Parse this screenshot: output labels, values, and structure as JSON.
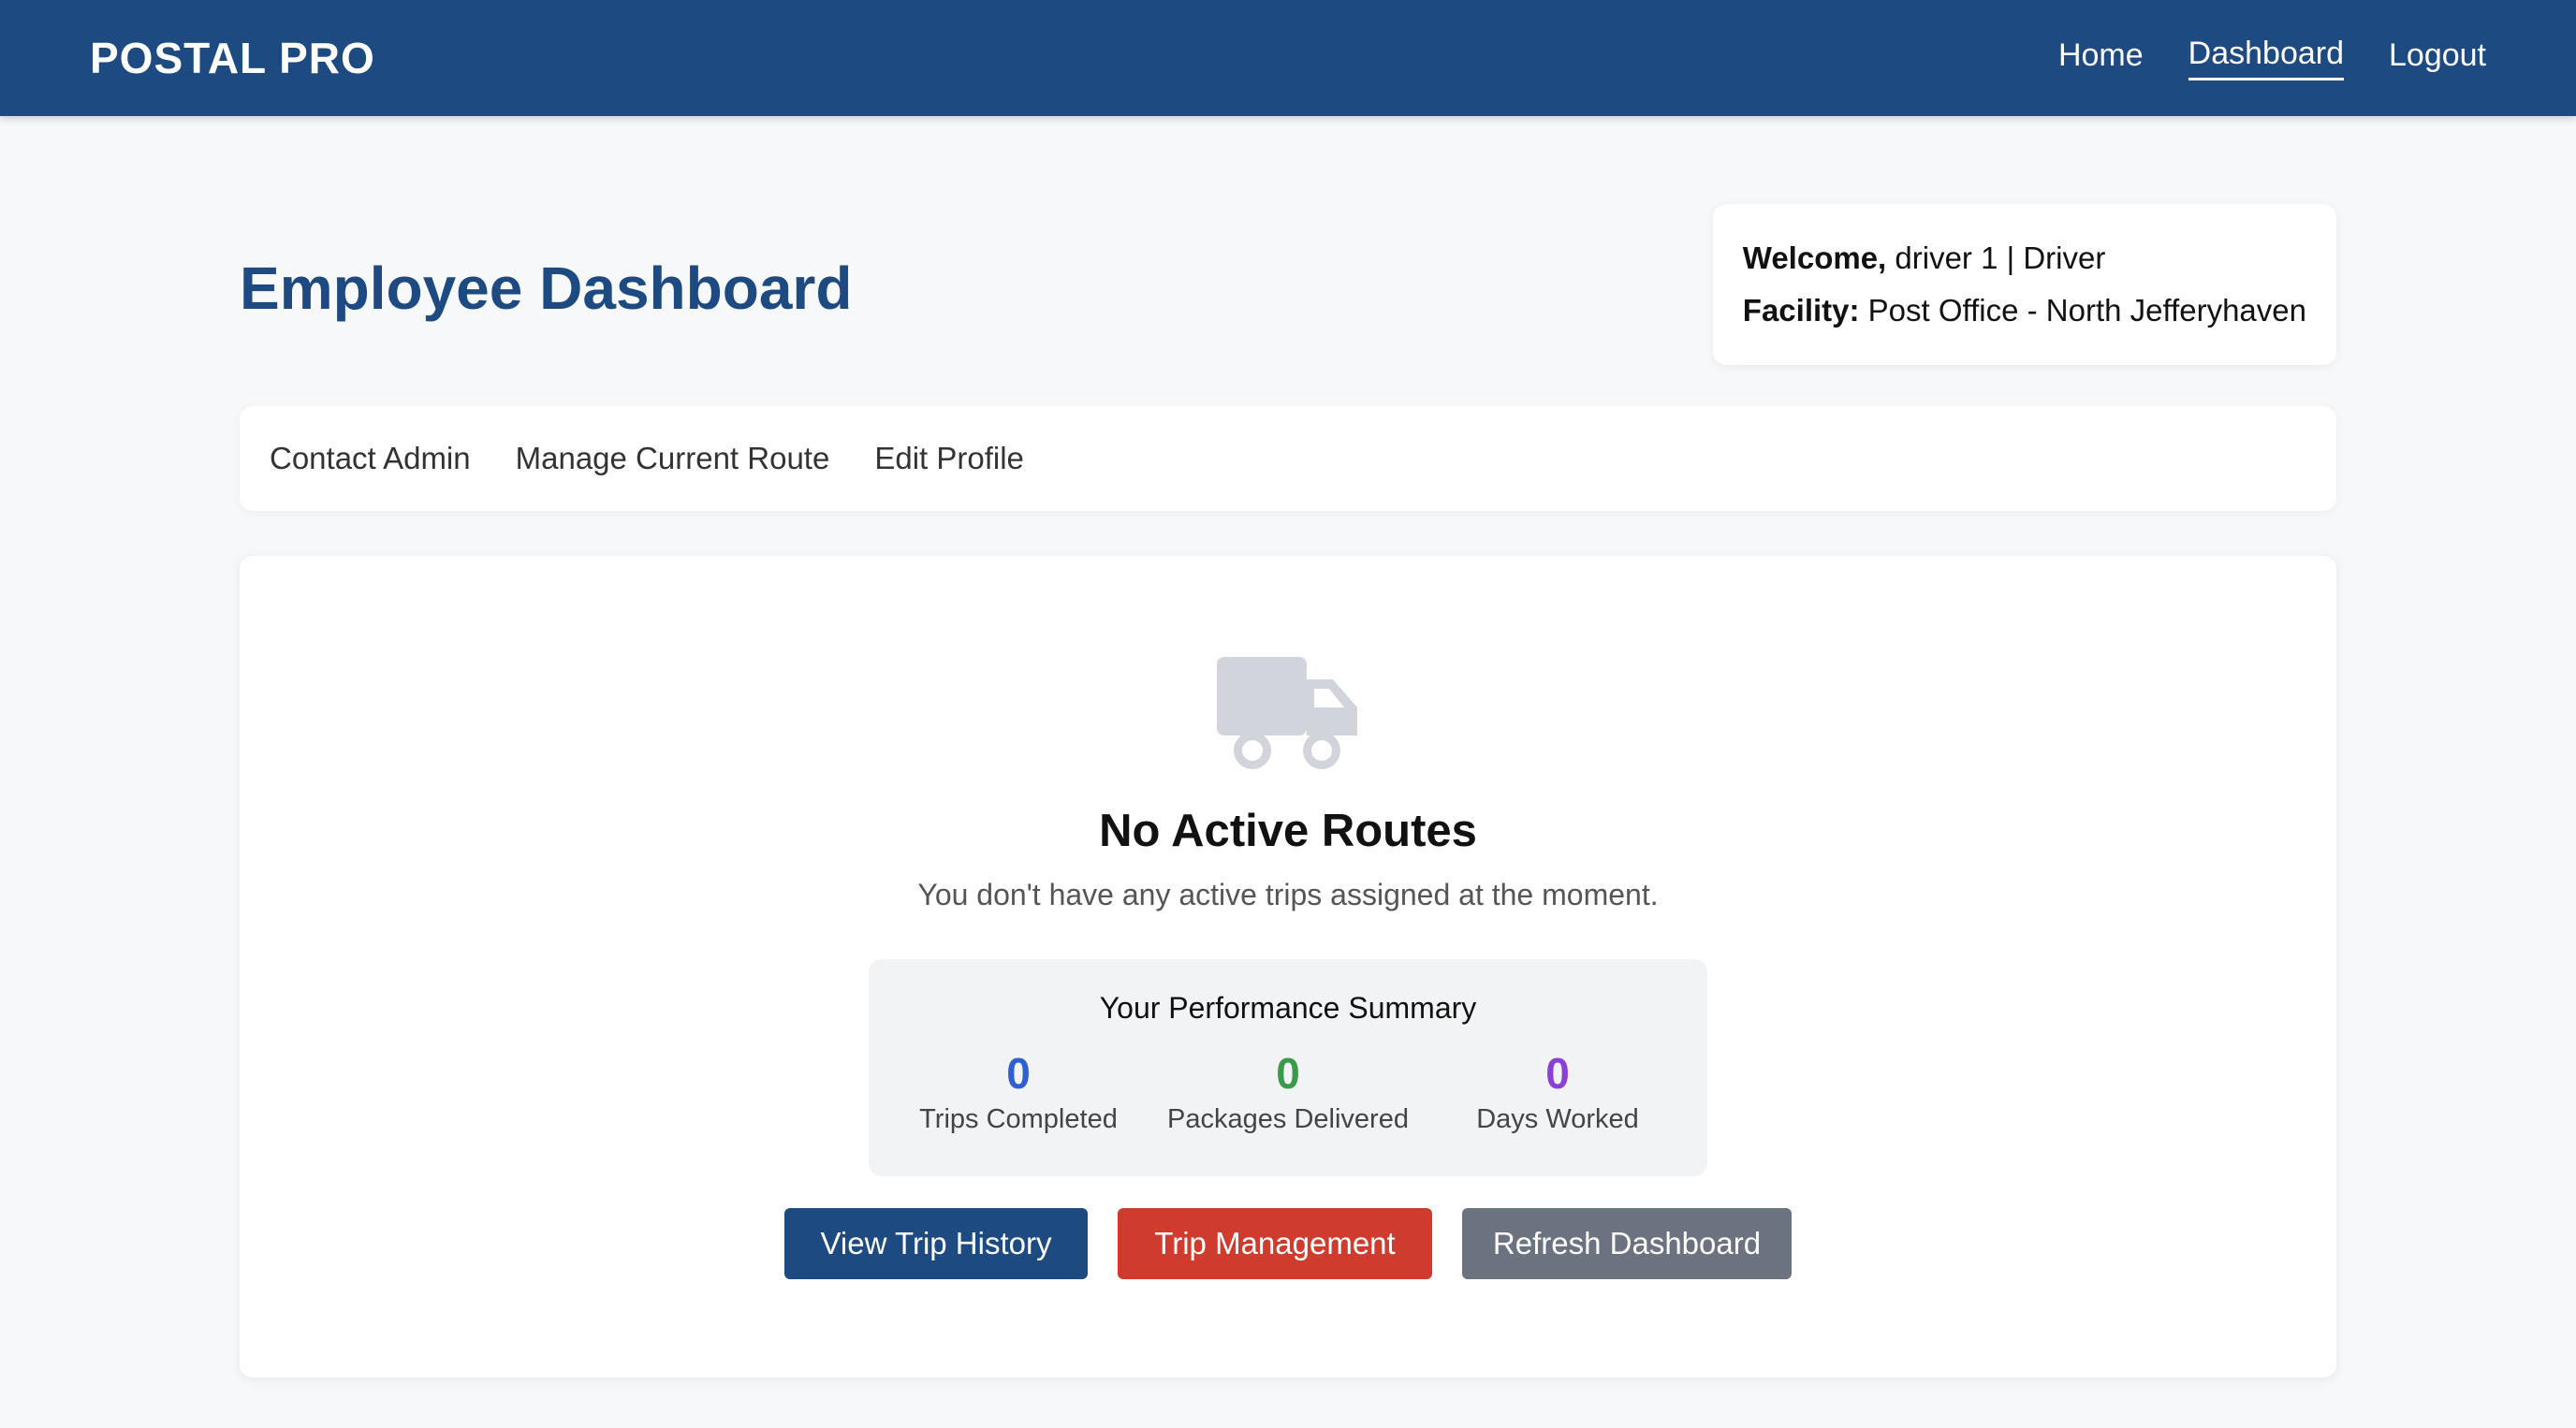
{
  "nav": {
    "brand": "POSTAL PRO",
    "links": [
      "Home",
      "Dashboard",
      "Logout"
    ]
  },
  "page": {
    "title": "Employee Dashboard"
  },
  "welcome": {
    "welcome_label": "Welcome,",
    "user_text": "driver 1 | Driver",
    "facility_label": "Facility:",
    "facility_text": "Post Office - North Jefferyhaven"
  },
  "subnav": {
    "items": [
      "Contact Admin",
      "Manage Current Route",
      "Edit Profile"
    ]
  },
  "empty_state": {
    "icon": "truck-icon",
    "title": "No Active Routes",
    "subtitle": "You don't have any active trips assigned at the moment."
  },
  "performance": {
    "title": "Your Performance Summary",
    "stats": [
      {
        "value": "0",
        "label": "Trips Completed",
        "color": "#2f5fd0"
      },
      {
        "value": "0",
        "label": "Packages Delivered",
        "color": "#3a9a4a"
      },
      {
        "value": "0",
        "label": "Days Worked",
        "color": "#8a3fd6"
      }
    ]
  },
  "actions": {
    "view_history": "View Trip History",
    "trip_management": "Trip Management",
    "refresh": "Refresh Dashboard"
  },
  "colors": {
    "brand": "#1e4a82",
    "danger": "#cf3b2d",
    "secondary": "#6b7280",
    "icon_gray": "#d1d5db"
  }
}
